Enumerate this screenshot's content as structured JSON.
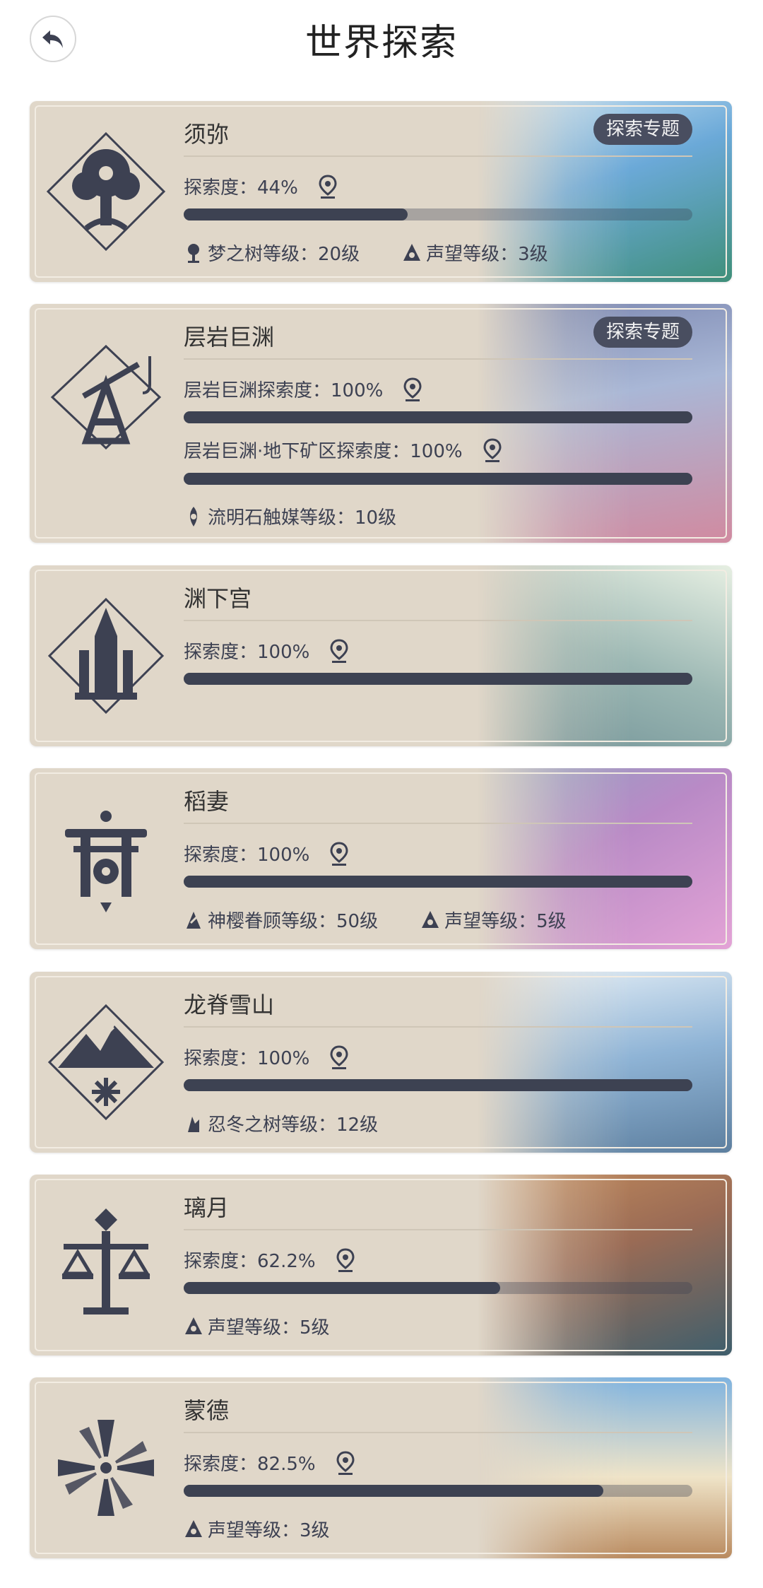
{
  "header": {
    "title": "世界探索",
    "back_icon": "back-arrow-icon"
  },
  "regions": [
    {
      "name": "须弥",
      "emblem_icon": "sumeru-tree-emblem-icon",
      "topic": "探索专题",
      "stats": [
        {
          "label": "探索度：44%",
          "progress": 0.44
        }
      ],
      "levels": [
        {
          "icon": "dendro-tree-icon",
          "text": "梦之树等级：20级"
        },
        {
          "icon": "reputation-icon",
          "text": "声望等级：3级"
        }
      ],
      "scene_colors": [
        "#6ba9d8",
        "#3f8f7a",
        "#cfe6f5"
      ]
    },
    {
      "name": "层岩巨渊",
      "emblem_icon": "chasm-crane-emblem-icon",
      "topic": "探索专题",
      "stats": [
        {
          "label": "层岩巨渊探索度：100%",
          "progress": 1.0
        },
        {
          "label": "层岩巨渊·地下矿区探索度：100%",
          "progress": 1.0
        }
      ],
      "levels": [
        {
          "icon": "lumenstone-icon",
          "text": "流明石触媒等级：10级"
        }
      ],
      "scene_colors": [
        "#a9b7d6",
        "#d18aa0",
        "#7b87b0"
      ]
    },
    {
      "name": "渊下宫",
      "emblem_icon": "enkanomiya-emblem-icon",
      "topic": "",
      "stats": [
        {
          "label": "探索度：100%",
          "progress": 1.0
        }
      ],
      "levels": [],
      "scene_colors": [
        "#9bb7b3",
        "#e6efe2",
        "#6f9095"
      ]
    },
    {
      "name": "稻妻",
      "emblem_icon": "inazuma-torii-emblem-icon",
      "topic": "",
      "stats": [
        {
          "label": "探索度：100%",
          "progress": 1.0
        }
      ],
      "levels": [
        {
          "icon": "sakura-icon",
          "text": "神樱眷顾等级：50级"
        },
        {
          "icon": "reputation-icon",
          "text": "声望等级：5级"
        }
      ],
      "scene_colors": [
        "#e3a3d6",
        "#b98ac6",
        "#8fa3c2"
      ]
    },
    {
      "name": "龙脊雪山",
      "emblem_icon": "dragonspine-emblem-icon",
      "topic": "",
      "stats": [
        {
          "label": "探索度：100%",
          "progress": 1.0
        }
      ],
      "levels": [
        {
          "icon": "frostbearing-tree-icon",
          "text": "忍冬之树等级：12级"
        }
      ],
      "scene_colors": [
        "#8fb4d6",
        "#e7f0f7",
        "#5d7f9f"
      ]
    },
    {
      "name": "璃月",
      "emblem_icon": "liyue-scale-emblem-icon",
      "topic": "",
      "stats": [
        {
          "label": "探索度：62.2%",
          "progress": 0.622
        }
      ],
      "levels": [
        {
          "icon": "reputation-icon",
          "text": "声望等级：5级"
        }
      ],
      "scene_colors": [
        "#9a6b55",
        "#3e5e6c",
        "#c58d5c"
      ]
    },
    {
      "name": "蒙德",
      "emblem_icon": "mondstadt-windmill-emblem-icon",
      "topic": "",
      "stats": [
        {
          "label": "探索度：82.5%",
          "progress": 0.825
        }
      ],
      "levels": [
        {
          "icon": "reputation-icon",
          "text": "声望等级：3级"
        }
      ],
      "scene_colors": [
        "#7fb3df",
        "#efe4c8",
        "#b98a5f"
      ]
    }
  ],
  "colors": {
    "card_bg": "#e0d7c9",
    "bar_fill": "#3d4252",
    "badge_bg": "#494e60",
    "text": "#3d4152"
  }
}
